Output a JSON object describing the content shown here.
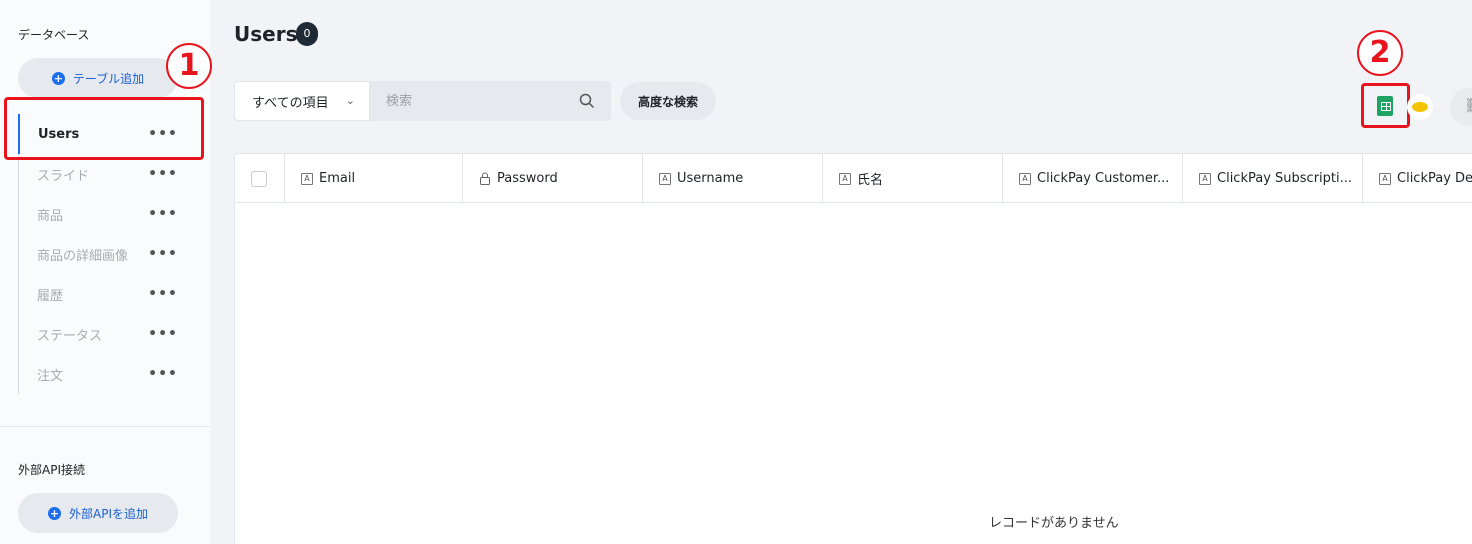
{
  "sidebar": {
    "database_title": "データベース",
    "add_table_label": "テーブル追加",
    "tables": [
      {
        "label": "Users",
        "active": true
      },
      {
        "label": "スライド",
        "active": false
      },
      {
        "label": "商品",
        "active": false
      },
      {
        "label": "商品の詳細画像",
        "active": false
      },
      {
        "label": "履歴",
        "active": false
      },
      {
        "label": "ステータス",
        "active": false
      },
      {
        "label": "注文",
        "active": false
      }
    ],
    "more_label": "•••",
    "external_api_title": "外部API接続",
    "add_api_label": "外部APIを追加"
  },
  "annotations": {
    "one": "1",
    "two": "2"
  },
  "main": {
    "title": "Users",
    "count": "0",
    "filter_selected": "すべての項目",
    "search_placeholder": "検索",
    "advanced_search_label": "高度な検索",
    "columns": [
      {
        "icon": "text-field-icon",
        "label": "Email"
      },
      {
        "icon": "lock-icon",
        "label": "Password"
      },
      {
        "icon": "text-field-icon",
        "label": "Username"
      },
      {
        "icon": "text-field-icon",
        "label": "氏名"
      },
      {
        "icon": "text-field-icon",
        "label": "ClickPay Customer..."
      },
      {
        "icon": "text-field-icon",
        "label": "ClickPay Subscripti..."
      },
      {
        "icon": "text-field-icon",
        "label": "ClickPay De"
      }
    ],
    "empty_message": "レコードがありません"
  },
  "colors": {
    "accent": "#1a6ef0",
    "annotation_red": "#e8141d",
    "sheets_green": "#1ea362"
  }
}
